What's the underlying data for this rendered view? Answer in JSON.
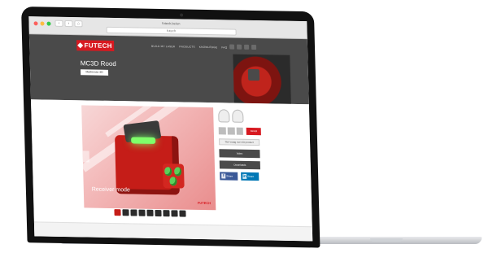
{
  "browser": {
    "tab_title": "futech.be/en",
    "url": "futech",
    "nav": [
      "‹",
      "›",
      "⌂"
    ]
  },
  "site": {
    "logo_text": "FUTECH",
    "top_nav": [
      "BUILD MY LASER",
      "PRODUCTS",
      "KNOWLEDGE",
      "FAQ"
    ],
    "product_title": "MC3D Rood",
    "product_tag": "Multicross 3D",
    "viewer_caption": "Receiver mode",
    "viewer_brand": "FUTECH",
    "side_panel": {
      "light_button": "Stel vraag over dit product",
      "dark_buttons": [
        "Video",
        "Downloads"
      ],
      "red_button": "Bestel",
      "share": [
        {
          "icon": "facebook-icon",
          "glyph": "f",
          "label": "Share"
        },
        {
          "icon": "linkedin-icon",
          "glyph": "in",
          "label": "Share"
        }
      ]
    }
  },
  "colors": {
    "brand_red": "#d71920",
    "header_dark": "#4a4a4a",
    "facebook_blue": "#3b5998",
    "linkedin_blue": "#0077b5"
  }
}
